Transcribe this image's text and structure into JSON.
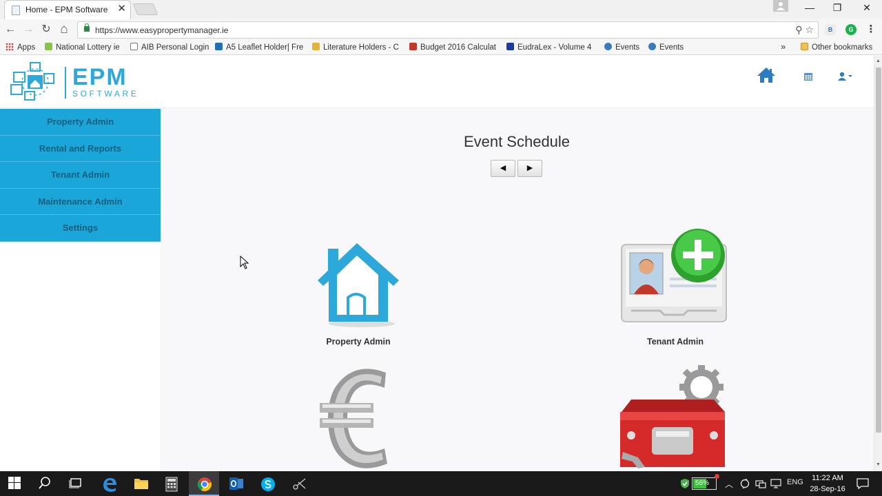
{
  "browser": {
    "tab": {
      "title": "Home - EPM Software",
      "close": "✕"
    },
    "window_controls": {
      "minimize": "—",
      "restore": "❐",
      "close": "✕"
    },
    "nav": {
      "back": "←",
      "forward": "→",
      "reload": "↻",
      "home": "⌂"
    },
    "address_bar": {
      "url": "https://www.easypropertymanager.ie"
    },
    "omnibox_icons": "⚲ ☆",
    "extensions": [
      "B",
      "G",
      "⋮"
    ],
    "bookmarks": [
      {
        "label": "Apps",
        "icon": "apps-grid-icon"
      },
      {
        "label": "National Lottery ie",
        "icon": "lottery-icon"
      },
      {
        "label": "AIB Personal Login",
        "icon": "page-icon"
      },
      {
        "label": "A5 Leaflet Holder| Fre",
        "icon": "leaflet-icon"
      },
      {
        "label": "Literature Holders - C",
        "icon": "literature-icon"
      },
      {
        "label": "Budget 2016 Calculat",
        "icon": "budget-icon"
      },
      {
        "label": "EudraLex - Volume 4",
        "icon": "eu-icon"
      },
      {
        "label": "Events",
        "icon": "events-icon"
      },
      {
        "label": "Events",
        "icon": "events-icon"
      }
    ],
    "bookmarks_overflow": "»",
    "other_bookmarks": "Other bookmarks"
  },
  "app": {
    "logo": {
      "title": "EPM",
      "subtitle": "SOFTWARE"
    },
    "header_icons": [
      "home-icon",
      "calendar-icon",
      "user-menu-icon"
    ],
    "sidebar": [
      {
        "label": "Property Admin"
      },
      {
        "label": "Rental and Reports"
      },
      {
        "label": "Tenant Admin"
      },
      {
        "label": "Maintenance Admin"
      },
      {
        "label": "Settings"
      }
    ],
    "event_schedule": {
      "title": "Event Schedule",
      "prev": "◀",
      "next": "▶"
    },
    "tiles": [
      {
        "label": "Property Admin",
        "icon": "house-icon"
      },
      {
        "label": "Tenant Admin",
        "icon": "tenant-card-icon"
      },
      {
        "label": "",
        "icon": "euro-icon"
      },
      {
        "label": "",
        "icon": "toolbox-icon"
      }
    ]
  },
  "taskbar": {
    "battery": "56%",
    "language": "ENG",
    "time": "11:22 AM",
    "date": "28-Sep-16"
  },
  "colors": {
    "sidebar": "#1ba6d9",
    "brand": "#2ca9da",
    "header_icon": "#2c7cc1"
  }
}
